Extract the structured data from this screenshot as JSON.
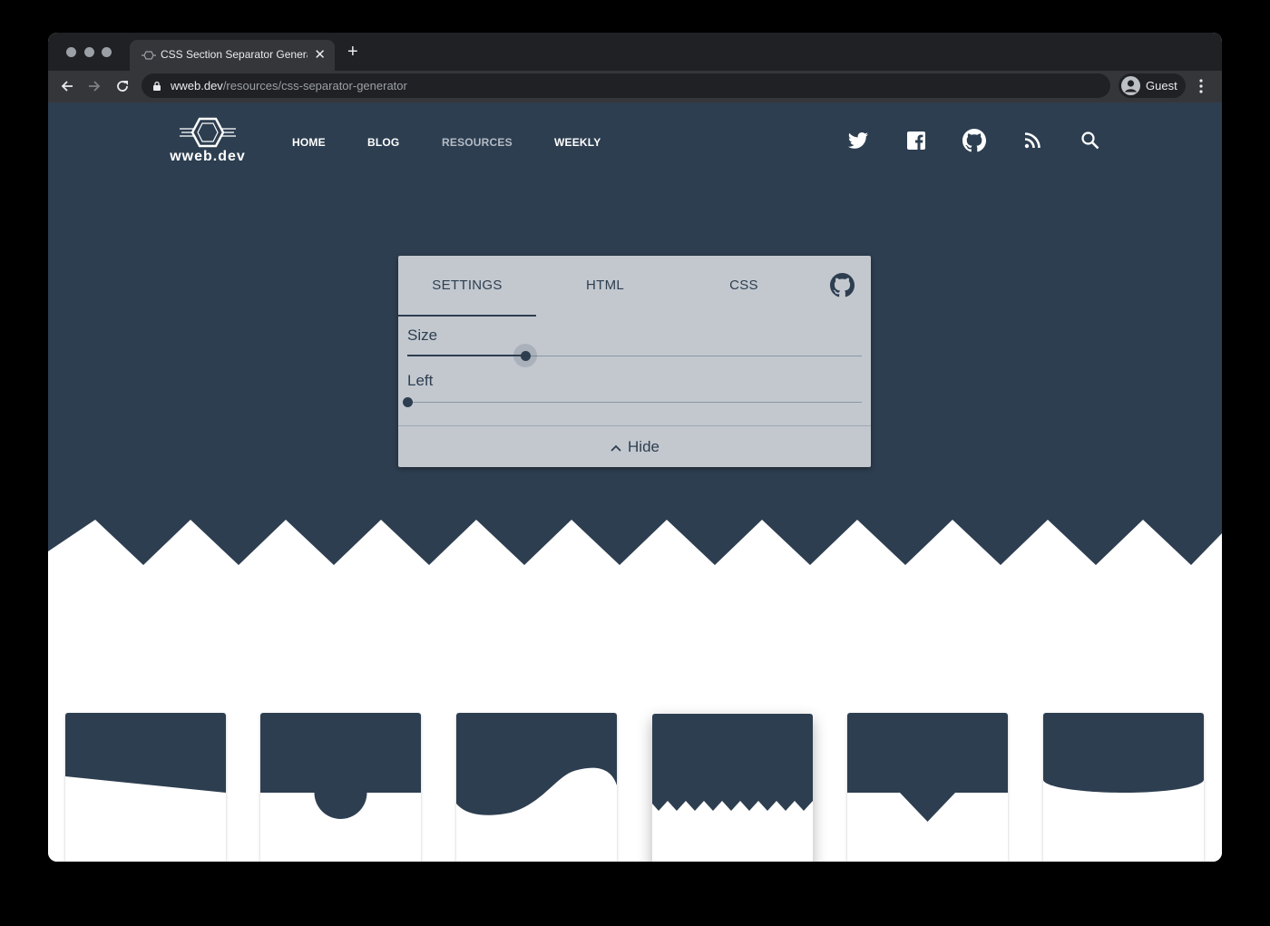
{
  "browser": {
    "tab_title": "CSS Section Separator Generator",
    "url_host": "wweb.dev",
    "url_path": "/resources/css-separator-generator",
    "profile_label": "Guest"
  },
  "site": {
    "logo_text": "wweb.dev",
    "nav": [
      {
        "label": "HOME",
        "active": false
      },
      {
        "label": "BLOG",
        "active": false
      },
      {
        "label": "RESOURCES",
        "active": true
      },
      {
        "label": "WEEKLY",
        "active": false
      }
    ],
    "social_icons": [
      "twitter-icon",
      "facebook-icon",
      "github-icon",
      "rss-icon",
      "search-icon"
    ]
  },
  "panel": {
    "tabs": [
      {
        "label": "SETTINGS",
        "selected": true
      },
      {
        "label": "HTML",
        "selected": false
      },
      {
        "label": "CSS",
        "selected": false
      }
    ],
    "sliders": [
      {
        "label": "Size",
        "value": 0.26
      },
      {
        "label": "Left",
        "value": 0.0
      }
    ],
    "hide_label": "Hide"
  },
  "separators": {
    "options": [
      "slant",
      "circle",
      "wave",
      "zigzag",
      "triangle",
      "curve"
    ],
    "selected": "zigzag"
  },
  "colors": {
    "brand": "#2d3e50",
    "panel": "#c3c8cf"
  }
}
